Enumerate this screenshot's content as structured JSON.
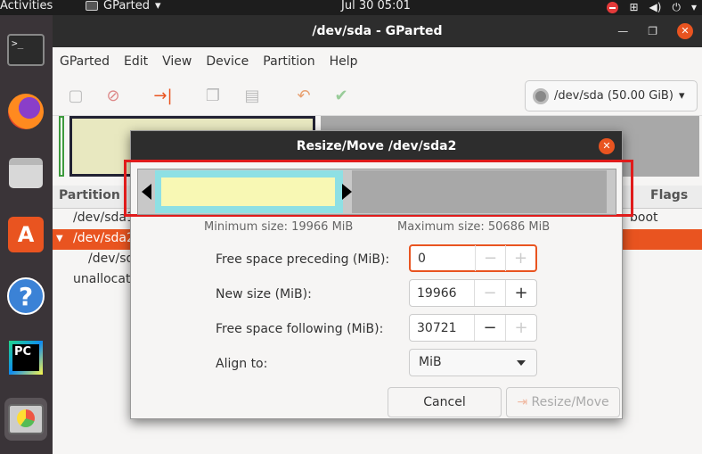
{
  "topbar": {
    "activities": "Activities",
    "app_name": "GParted",
    "clock": "Jul 30  05:01"
  },
  "dock": {
    "terminal_prompt": ">_",
    "store_glyph": "A",
    "help_glyph": "?",
    "pycharm_glyph": "PC"
  },
  "window": {
    "title": "/dev/sda - GParted",
    "menu": [
      "GParted",
      "Edit",
      "View",
      "Device",
      "Partition",
      "Help"
    ],
    "device_selector": "/dev/sda (50.00 GiB)",
    "table": {
      "headers": {
        "partition": "Partition",
        "flags": "Flags"
      },
      "rows": [
        {
          "partition": "/dev/sda1",
          "flags": "boot"
        },
        {
          "partition": "/dev/sda2",
          "flags": ""
        },
        {
          "partition": "/dev/sda5",
          "flags": ""
        },
        {
          "partition": "unallocated",
          "flags": ""
        }
      ]
    }
  },
  "dialog": {
    "title": "Resize/Move /dev/sda2",
    "min_size": "Minimum size: 19966 MiB",
    "max_size": "Maximum size: 50686 MiB",
    "fields": {
      "preceding_label": "Free space preceding (MiB):",
      "preceding_value": "0",
      "new_size_label": "New size (MiB):",
      "new_size_value": "19966",
      "following_label": "Free space following (MiB):",
      "following_value": "30721",
      "align_label": "Align to:",
      "align_value": "MiB"
    },
    "cancel": "Cancel",
    "resize_move": "Resize/Move",
    "bar_fraction": {
      "start": 0,
      "size": 19966,
      "total": 50687
    }
  },
  "colors": {
    "accent": "#e95420",
    "highlight": "#e01b1b"
  }
}
